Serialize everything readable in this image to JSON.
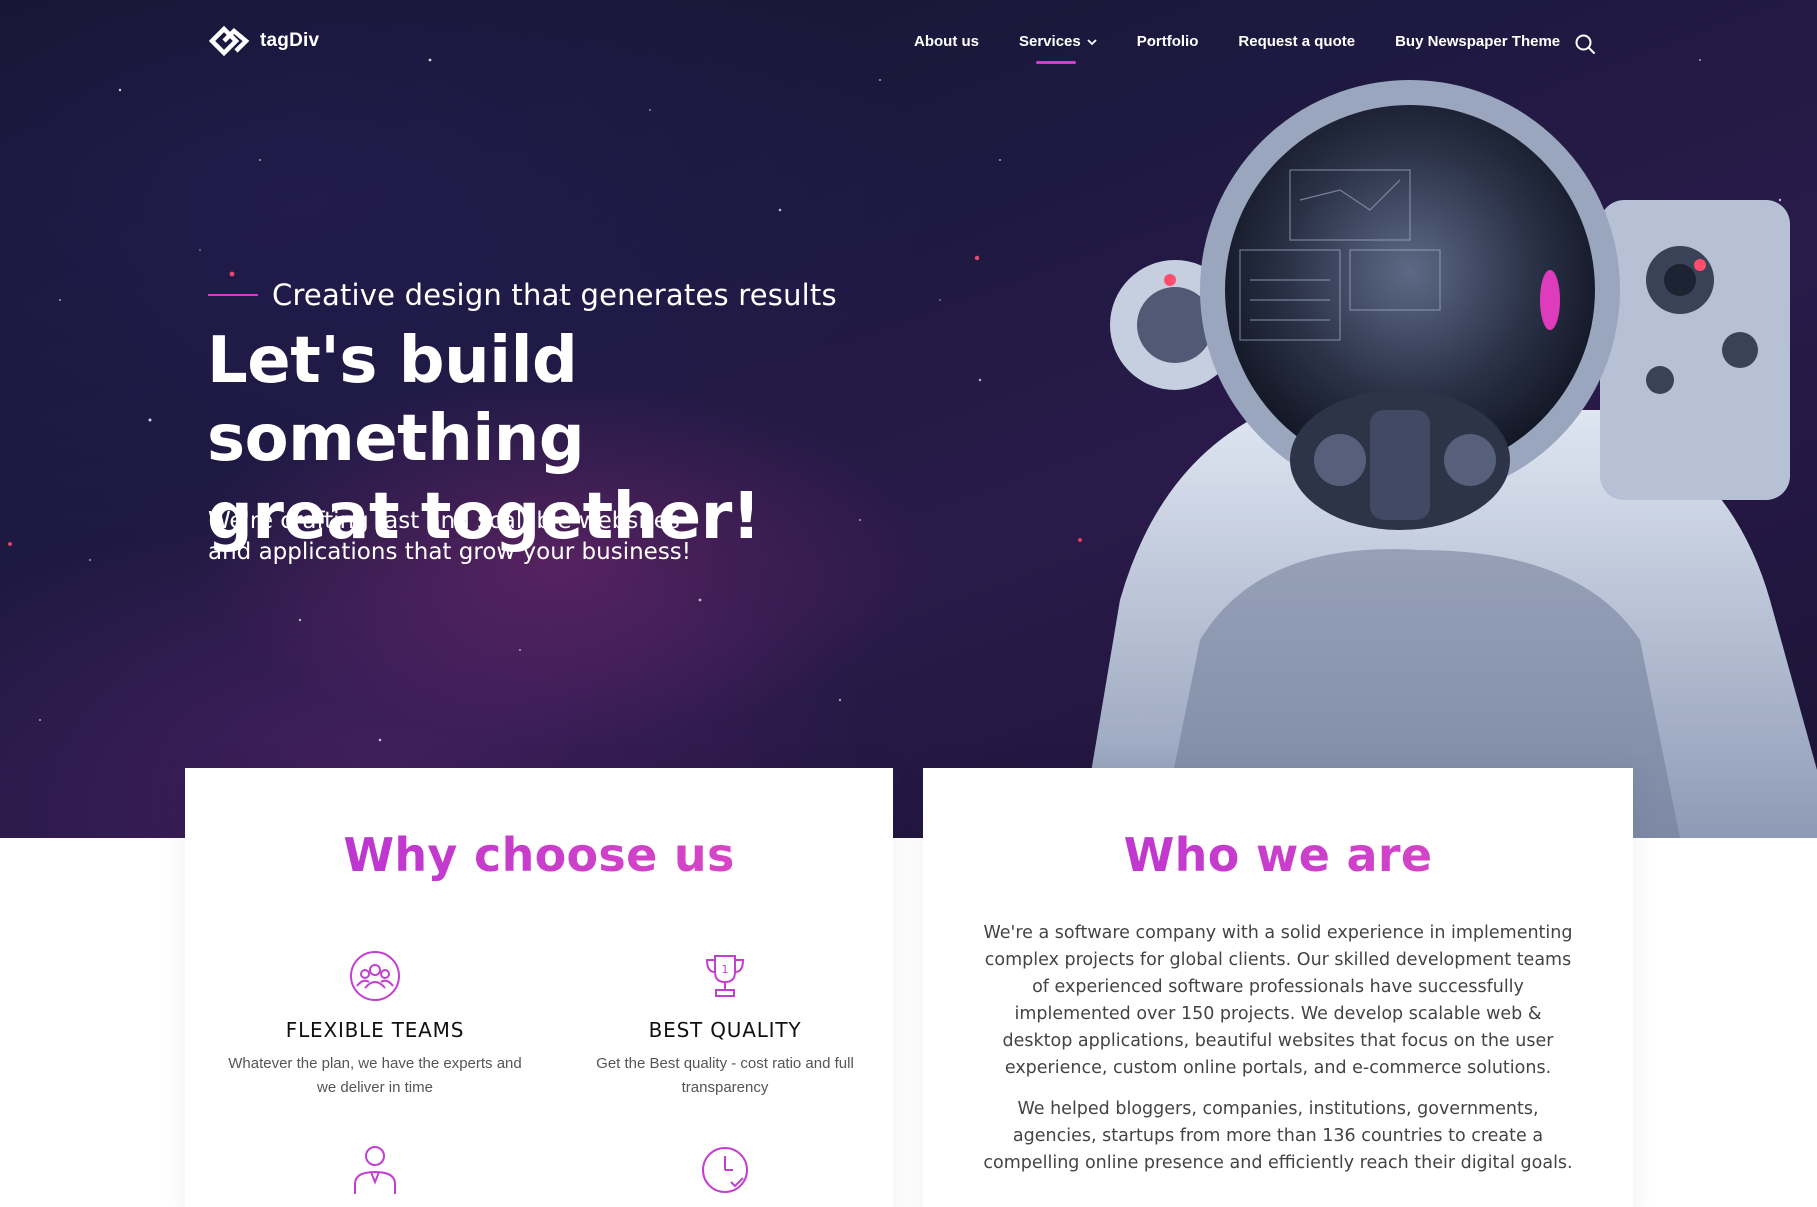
{
  "header": {
    "logo_text": "tagDiv",
    "nav": [
      {
        "label": "About us"
      },
      {
        "label": "Services"
      },
      {
        "label": "Portfolio"
      },
      {
        "label": "Request a quote"
      },
      {
        "label": "Buy Newspaper Theme"
      }
    ],
    "active_nav": "Services",
    "icons": {
      "logo": "tagdiv-logo-icon",
      "dropdown": "chevron-down-icon",
      "search": "search-icon"
    }
  },
  "hero": {
    "tagline": "Creative design that generates results",
    "headline_line1": "Let's build something",
    "headline_line2": "great together!",
    "subtext": "We're crafting fast and scalable websites and applications that grow your business!",
    "image": "astronaut-illustration"
  },
  "why": {
    "title": "Why choose us",
    "features": [
      {
        "title": "FLEXIBLE TEAMS",
        "desc": "Whatever the plan, we have the experts and we deliver in time",
        "icon": "team-icon"
      },
      {
        "title": "BEST QUALITY",
        "desc": "Get the Best quality - cost ratio and full transparency",
        "icon": "trophy-icon"
      },
      {
        "icon": "person-icon"
      },
      {
        "icon": "clock-check-icon"
      }
    ]
  },
  "who": {
    "title": "Who we are",
    "p1": "We're a software company with a solid experience in implementing complex projects for global clients. Our skilled development teams of experienced software professionals have successfully implemented over 150 projects. We develop scalable web & desktop applications, beautiful websites that focus on the user experience, custom online portals, and e-commerce solutions.",
    "p2": "We helped bloggers, companies, institutions, governments, agencies, startups from more than 136 countries to create a compelling online presence and efficiently reach their digital goals."
  },
  "colors": {
    "accent": "#d63bd1",
    "title_gradient_start": "#b12fd4",
    "title_gradient_end": "#e24cc2",
    "hero_bg": "#1d1940"
  }
}
